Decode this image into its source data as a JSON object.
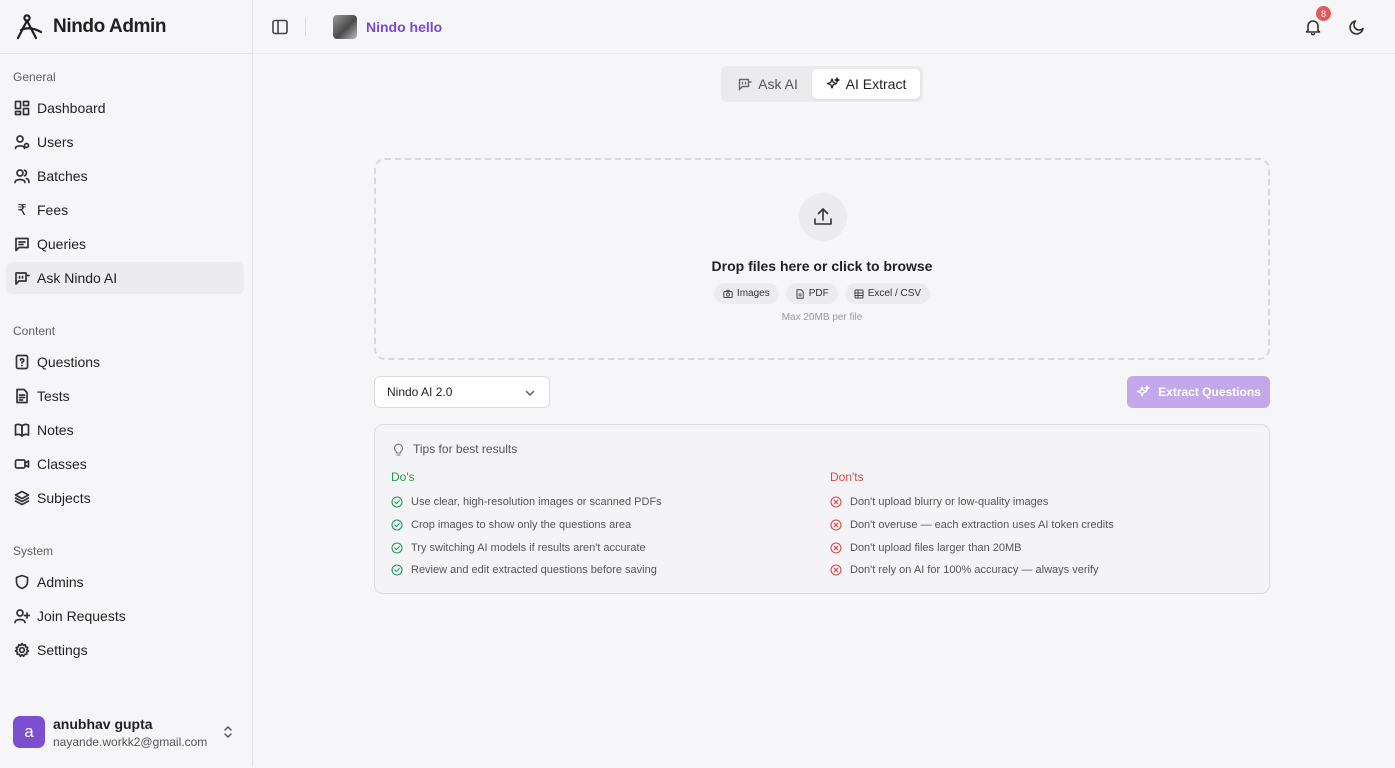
{
  "app": {
    "name": "Nindo Admin"
  },
  "sidebar": {
    "sections": [
      {
        "label": "General"
      },
      {
        "label": "Content"
      },
      {
        "label": "System"
      }
    ],
    "items": [
      {
        "label": "Dashboard",
        "icon": "dashboard-icon"
      },
      {
        "label": "Users",
        "icon": "users-icon"
      },
      {
        "label": "Batches",
        "icon": "batches-icon"
      },
      {
        "label": "Fees",
        "icon": "rupee-icon"
      },
      {
        "label": "Queries",
        "icon": "queries-icon"
      },
      {
        "label": "Ask Nindo AI",
        "icon": "bot-chat-icon",
        "active": true
      },
      {
        "label": "Questions",
        "icon": "question-file-icon"
      },
      {
        "label": "Tests",
        "icon": "tests-icon"
      },
      {
        "label": "Notes",
        "icon": "book-icon"
      },
      {
        "label": "Classes",
        "icon": "video-icon"
      },
      {
        "label": "Subjects",
        "icon": "layers-icon"
      },
      {
        "label": "Admins",
        "icon": "shield-icon"
      },
      {
        "label": "Join Requests",
        "icon": "user-plus-icon"
      },
      {
        "label": "Settings",
        "icon": "gear-icon"
      }
    ],
    "rupee_symbol": "₹",
    "user": {
      "initial": "a",
      "name": "anubhav gupta",
      "email": "nayande.workk2@gmail.com"
    }
  },
  "header": {
    "space_name": "Nindo hello",
    "notification_count": "8"
  },
  "tabs": [
    {
      "label": "Ask AI",
      "icon": "chat-bot-icon"
    },
    {
      "label": "AI Extract",
      "icon": "sparkles-icon",
      "active": true
    }
  ],
  "upload": {
    "title": "Drop files here or click to browse",
    "chips": [
      "Images",
      "PDF",
      "Excel / CSV"
    ],
    "note": "Max 20MB per file"
  },
  "model_select": {
    "value": "Nindo AI 2.0"
  },
  "extract_button": {
    "label": "Extract Questions"
  },
  "tips": {
    "title": "Tips for best results",
    "dos_title": "Do's",
    "donts_title": "Don'ts",
    "dos": [
      "Use clear, high-resolution images or scanned PDFs",
      "Crop images to show only the questions area",
      "Try switching AI models if results aren't accurate",
      "Review and edit extracted questions before saving"
    ],
    "donts": [
      "Don't upload blurry or low-quality images",
      "Don't overuse — each extraction uses AI token credits",
      "Don't upload files larger than 20MB",
      "Don't rely on AI for 100% accuracy — always verify"
    ]
  },
  "colors": {
    "accent": "#7a49c9",
    "avatar": "#7c4fd0",
    "button_disabled": "#c2a9ea",
    "do": "#1f9a5b",
    "dont": "#d24b4b",
    "badge": "#e35a5a"
  }
}
